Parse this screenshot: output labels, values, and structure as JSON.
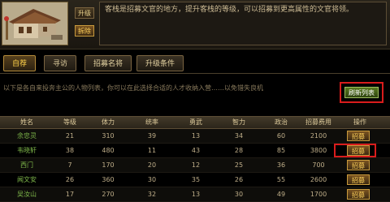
{
  "building": {
    "upgrade_label": "升级",
    "demolish_label": "拆除",
    "description": "客栈是招募文官的地方，提升客栈的等级，可以招募到更高属性的文官将领。"
  },
  "tabs": [
    {
      "label": "自荐",
      "active": true
    },
    {
      "label": "寻访",
      "active": false
    },
    {
      "label": "招募名将",
      "active": false
    },
    {
      "label": "升级条件",
      "active": false
    }
  ],
  "info_text": "以下是各自来投奔主公的人物列表，你可以在此选择合适的人才收纳入营……以免错失良机",
  "refresh_label": "刷新列表",
  "table": {
    "headers": [
      "姓名",
      "等级",
      "体力",
      "统率",
      "勇武",
      "智力",
      "政治",
      "招募费用",
      "操作"
    ],
    "rows": [
      {
        "name": "余忠灵",
        "level": "21",
        "hp": "310",
        "lead": "39",
        "brave": "13",
        "int": "34",
        "pol": "60",
        "cost": "2100",
        "action": "招募"
      },
      {
        "name": "韦晓轩",
        "level": "38",
        "hp": "480",
        "lead": "11",
        "brave": "43",
        "int": "28",
        "pol": "85",
        "cost": "3800",
        "action": "招募",
        "highlight": true
      },
      {
        "name": "西门",
        "level": "7",
        "hp": "170",
        "lead": "20",
        "brave": "12",
        "int": "25",
        "pol": "36",
        "cost": "700",
        "action": "招募"
      },
      {
        "name": "闻文安",
        "level": "26",
        "hp": "360",
        "lead": "30",
        "brave": "35",
        "int": "26",
        "pol": "55",
        "cost": "2600",
        "action": "招募"
      },
      {
        "name": "吴汝山",
        "level": "17",
        "hp": "270",
        "lead": "32",
        "brave": "13",
        "int": "30",
        "pol": "49",
        "cost": "1700",
        "action": "招募"
      }
    ]
  }
}
